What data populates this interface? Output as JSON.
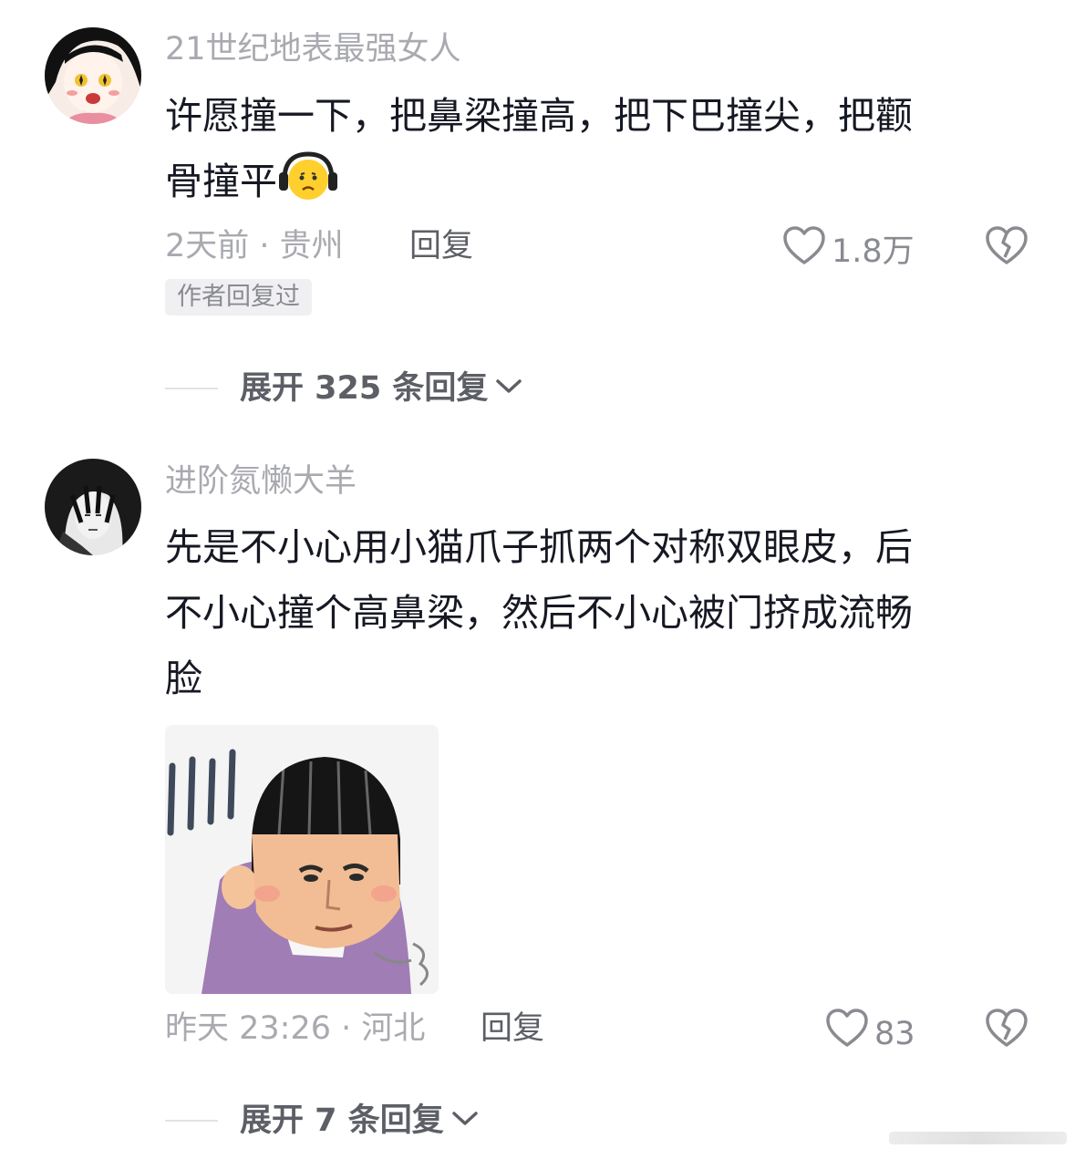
{
  "comments": [
    {
      "username": "21世纪地表最强女人",
      "text_line1": "许愿撞一下，把鼻梁撞高，把下巴撞尖，把颧",
      "text_line2": "骨撞平",
      "emoji": "headphones-face-emoji",
      "time_location": "2天前 · 贵州",
      "reply_label": "回复",
      "likes": "1.8万",
      "badge": "作者回复过",
      "expand_label": "展开 325 条回复"
    },
    {
      "username": "进阶氮懒大羊",
      "text_line1": "先是不小心用小猫爪子抓两个对称双眼皮，后",
      "text_line2": "不小心撞个高鼻梁，然后不小心被门挤成流畅",
      "text_line3": "脸",
      "sticker": "meme-sticker-image",
      "time_location": "昨天 23:26 · 河北",
      "reply_label": "回复",
      "likes": "83",
      "expand_label": "展开 7 条回复"
    }
  ],
  "icons": {
    "like": "heart-outline-icon",
    "dislike": "broken-heart-icon",
    "expand": "chevron-down-icon"
  },
  "colors": {
    "username": "#a9aab0",
    "text": "#161823",
    "secondary": "#5d5f66",
    "badge_bg": "#f0f0f2"
  }
}
